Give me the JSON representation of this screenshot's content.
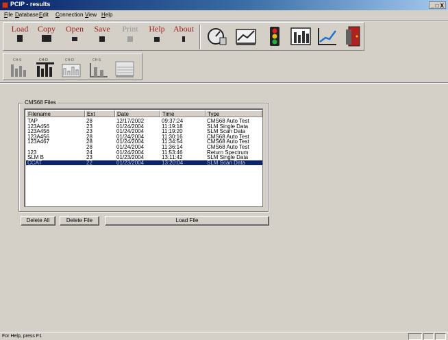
{
  "window": {
    "title": "PCIP - results",
    "controls": "_ □ X"
  },
  "menu": [
    "File",
    "Database",
    "Edit",
    "Connection",
    "View",
    "Help"
  ],
  "toolbar": {
    "buttons": [
      {
        "label": "Load",
        "icon": "load-icon",
        "enabled": true
      },
      {
        "label": "Copy",
        "icon": "copy-icon",
        "enabled": true
      },
      {
        "label": "Open",
        "icon": "open-icon",
        "enabled": true
      },
      {
        "label": "Save",
        "icon": "save-icon",
        "enabled": true
      },
      {
        "label": "Print",
        "icon": "print-icon",
        "enabled": false
      },
      {
        "label": "Help",
        "icon": "help-icon",
        "enabled": true
      },
      {
        "label": "About",
        "icon": "about-icon",
        "enabled": true
      }
    ],
    "tool_icons": [
      "meter-icon",
      "graph-plot-icon",
      "traffic-light-icon",
      "bar-chart-icon",
      "line-chart-icon",
      "exit-door-icon"
    ],
    "view_icons": [
      {
        "icon": "chart-view-1-icon",
        "caption": "CH-S"
      },
      {
        "icon": "chart-view-2-icon",
        "caption": "CH-D"
      },
      {
        "icon": "chart-view-3-icon",
        "caption": "CH-D"
      },
      {
        "icon": "chart-view-4-icon",
        "caption": "CH-S"
      },
      {
        "icon": "chart-view-5-icon",
        "caption": ""
      }
    ]
  },
  "files_panel": {
    "title": "CMS68 Files",
    "columns": [
      "Filename",
      "Ext",
      "Date",
      "Time",
      "Type"
    ],
    "rows": [
      {
        "filename": "TAP",
        "ext": "28",
        "date": "12/17/2002",
        "time": "09:37:24",
        "type": "CMS68 Auto Test",
        "selected": false
      },
      {
        "filename": "123A456",
        "ext": "23",
        "date": "01/24/2004",
        "time": "11:19:18",
        "type": "SLM Single Data",
        "selected": false
      },
      {
        "filename": "123A456",
        "ext": "23",
        "date": "01/24/2004",
        "time": "11:19:20",
        "type": "SLM Scan Data",
        "selected": false
      },
      {
        "filename": "123A456",
        "ext": "28",
        "date": "01/24/2004",
        "time": "11:30:16",
        "type": "CMS68 Auto Test",
        "selected": false
      },
      {
        "filename": "123A467",
        "ext": "28",
        "date": "01/24/2004",
        "time": "11:34:54",
        "type": "CMS68 Auto Test",
        "selected": false
      },
      {
        "filename": "",
        "ext": "28",
        "date": "01/24/2004",
        "time": "11:36:14",
        "type": "CMS68 Auto Test",
        "selected": false
      },
      {
        "filename": "123",
        "ext": "24",
        "date": "01/24/2004",
        "time": "11:53:46",
        "type": "Return Spectrum",
        "selected": false
      },
      {
        "filename": "SLM B",
        "ext": "23",
        "date": "01/23/2004",
        "time": "13:11:42",
        "type": "SLM Single Data",
        "selected": false
      },
      {
        "filename": "CCAT",
        "ext": "22",
        "date": "01/23/2004",
        "time": "13:20:04",
        "type": "SLM Scan Data",
        "selected": true
      }
    ]
  },
  "buttons": {
    "delete_all": "Delete All",
    "delete_file": "Delete File",
    "load_file": "Load File"
  },
  "status": {
    "text": "For Help, press F1"
  }
}
